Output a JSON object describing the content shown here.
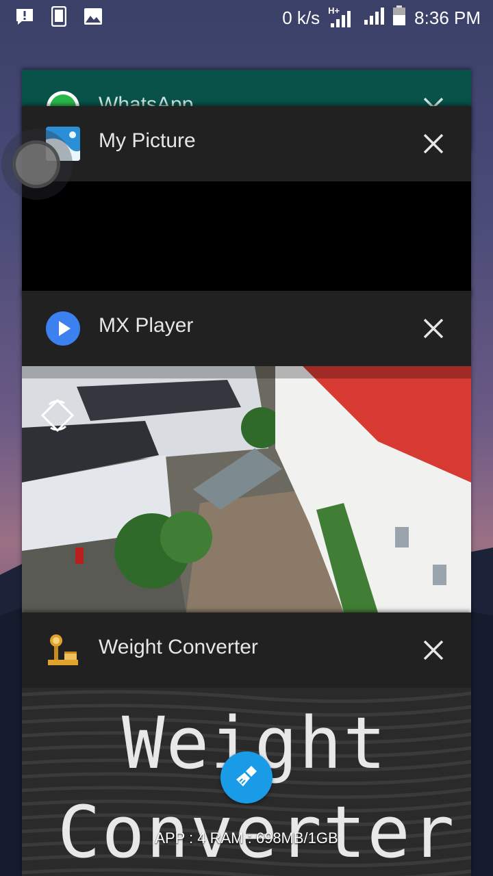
{
  "status_bar": {
    "net_speed": "0 k/s",
    "network_type": "H+",
    "time": "8:36 PM",
    "left_icons": [
      "alert-message-icon",
      "phone-icon",
      "image-icon"
    ],
    "right_icons": [
      "signal-sim1-icon",
      "signal-sim2-icon",
      "battery-icon"
    ]
  },
  "recents": [
    {
      "id": "whatsapp",
      "title": "WhatsApp",
      "icon": "whatsapp-icon"
    },
    {
      "id": "mypicture",
      "title": "My Picture",
      "icon": "gallery-icon"
    },
    {
      "id": "mx",
      "title": "MX Player",
      "icon": "mx-player-icon"
    },
    {
      "id": "wc",
      "title": "Weight Converter",
      "icon": "scale-icon",
      "preview_lines": [
        "Weight",
        "Converter"
      ]
    }
  ],
  "footer": {
    "memory_text": "APP : 4  RAM : 698MB/1GB"
  },
  "colors": {
    "card_bg": "#212121",
    "whatsapp_header": "#08524a",
    "clean_button": "#1a9be8"
  }
}
